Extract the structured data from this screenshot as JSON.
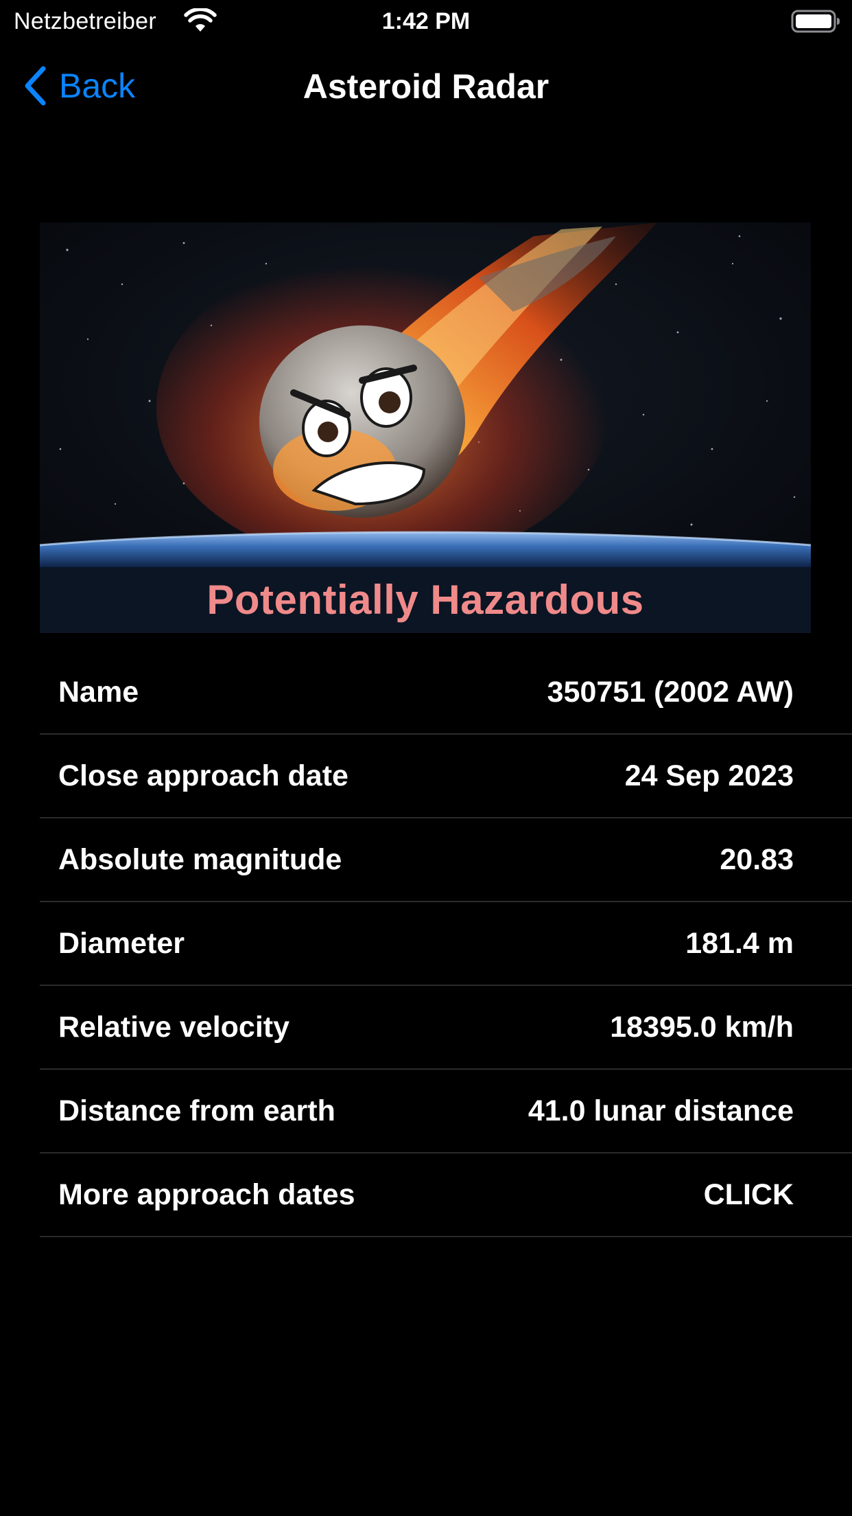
{
  "status_bar": {
    "carrier": "Netzbetreiber",
    "time": "1:42 PM"
  },
  "nav": {
    "back_label": "Back",
    "title": "Asteroid Radar"
  },
  "hero": {
    "caption": "Potentially Hazardous",
    "caption_color": "#f08a8a"
  },
  "details": {
    "rows": [
      {
        "label": "Name",
        "value": "350751 (2002 AW)"
      },
      {
        "label": "Close approach date",
        "value": "24 Sep 2023"
      },
      {
        "label": "Absolute magnitude",
        "value": "20.83"
      },
      {
        "label": "Diameter",
        "value": "181.4 m"
      },
      {
        "label": "Relative velocity",
        "value": "18395.0 km/h"
      },
      {
        "label": "Distance from earth",
        "value": "41.0 lunar distance"
      },
      {
        "label": "More approach dates",
        "value": "CLICK"
      }
    ]
  },
  "colors": {
    "background": "#000000",
    "accent": "#0a84ff",
    "separator": "#2b2b2d",
    "text": "#ffffff"
  },
  "icons": {
    "wifi": "wifi-icon",
    "battery": "battery-icon",
    "back": "chevron-left-icon"
  }
}
